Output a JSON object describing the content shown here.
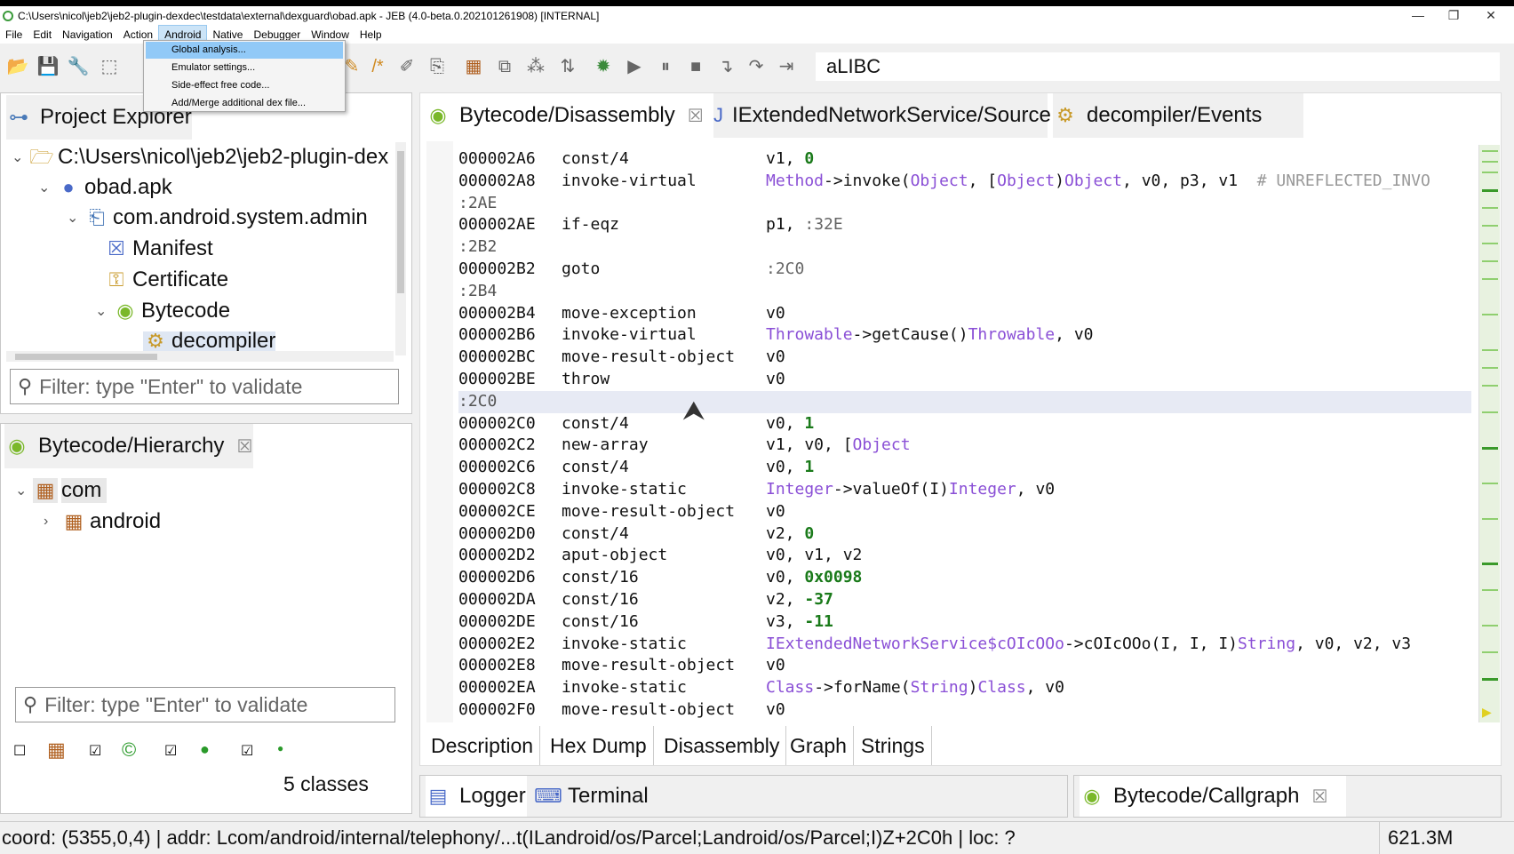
{
  "window": {
    "title": "C:\\Users\\nicol\\jeb2\\jeb2-plugin-dexdec\\testdata\\external\\dexguard\\obad.apk - JEB (4.0-beta.0.202101261908) [INTERNAL]",
    "minimize": "—",
    "restore": "❐",
    "close": "✕"
  },
  "menu": [
    "File",
    "Edit",
    "Navigation",
    "Action",
    "Android",
    "Native",
    "Debugger",
    "Window",
    "Help"
  ],
  "android_menu": [
    "Global analysis...",
    "Emulator settings...",
    "Side-effect free code...",
    "Add/Merge additional dex file..."
  ],
  "search": {
    "value": "aLIBC"
  },
  "project_explorer": {
    "tab": "Project Explorer",
    "tree": [
      {
        "label": "C:\\Users\\nicol\\jeb2\\jeb2-plugin-dex",
        "icon": "folder-icon"
      },
      {
        "label": "obad.apk",
        "icon": "apk-icon"
      },
      {
        "label": "com.android.system.admin",
        "icon": "package-icon"
      },
      {
        "label": "Manifest",
        "icon": "manifest-icon"
      },
      {
        "label": "Certificate",
        "icon": "key-icon"
      },
      {
        "label": "Bytecode",
        "icon": "android-icon"
      },
      {
        "label": "decompiler",
        "icon": "decompiler-icon"
      }
    ],
    "filter_placeholder": "Filter: type \"Enter\" to validate"
  },
  "hierarchy": {
    "tab": "Bytecode/Hierarchy",
    "tree": [
      {
        "label": "com"
      },
      {
        "label": "android"
      }
    ],
    "filter_placeholder": "Filter: type \"Enter\" to validate",
    "classes_count": "5 classes"
  },
  "editor_tabs": [
    "Bytecode/Disassembly",
    "IExtendedNetworkService/Source",
    "decompiler/Events"
  ],
  "code": [
    {
      "addr": "000002A6",
      "op": "const/4",
      "args": [
        [
          "v1, ",
          ""
        ],
        [
          "0",
          "n"
        ]
      ]
    },
    {
      "addr": "000002A8",
      "op": "invoke-virtual",
      "args": [
        [
          "Method",
          "t"
        ],
        [
          "->invoke(",
          ""
        ],
        [
          "Object",
          "t"
        ],
        [
          ", [",
          ""
        ],
        [
          "Object",
          "t"
        ],
        [
          ")",
          ""
        ],
        [
          "Object",
          "t"
        ],
        [
          ", v0, p3, v1  ",
          ""
        ],
        [
          "# UNREFLECTED_INVO",
          "c"
        ]
      ]
    },
    {
      "label": ":2AE"
    },
    {
      "addr": "000002AE",
      "op": "if-eqz",
      "args": [
        [
          "p1, ",
          ""
        ],
        [
          ":32E",
          "lbl"
        ]
      ]
    },
    {
      "label": ":2B2"
    },
    {
      "addr": "000002B2",
      "op": "goto",
      "args": [
        [
          ":2C0",
          "lbl"
        ]
      ]
    },
    {
      "label": ":2B4"
    },
    {
      "addr": "000002B4",
      "op": "move-exception",
      "args": [
        [
          "v0",
          ""
        ]
      ]
    },
    {
      "addr": "000002B6",
      "op": "invoke-virtual",
      "args": [
        [
          "Throwable",
          "t"
        ],
        [
          "->getCause()",
          ""
        ],
        [
          "Throwable",
          "t"
        ],
        [
          ", v0",
          ""
        ]
      ]
    },
    {
      "addr": "000002BC",
      "op": "move-result-object",
      "args": [
        [
          "v0",
          ""
        ]
      ]
    },
    {
      "addr": "000002BE",
      "op": "throw",
      "args": [
        [
          "v0",
          ""
        ]
      ]
    },
    {
      "label": ":2C0",
      "highlight": true
    },
    {
      "addr": "000002C0",
      "op": "const/4",
      "args": [
        [
          "v0, ",
          ""
        ],
        [
          "1",
          "n"
        ]
      ]
    },
    {
      "addr": "000002C2",
      "op": "new-array",
      "args": [
        [
          "v1, v0, [",
          ""
        ],
        [
          "Object",
          "t"
        ]
      ]
    },
    {
      "addr": "000002C6",
      "op": "const/4",
      "args": [
        [
          "v0, ",
          ""
        ],
        [
          "1",
          "n"
        ]
      ]
    },
    {
      "addr": "000002C8",
      "op": "invoke-static",
      "args": [
        [
          "Integer",
          "t"
        ],
        [
          "->valueOf(I)",
          ""
        ],
        [
          "Integer",
          "t"
        ],
        [
          ", v0",
          ""
        ]
      ]
    },
    {
      "addr": "000002CE",
      "op": "move-result-object",
      "args": [
        [
          "v0",
          ""
        ]
      ]
    },
    {
      "addr": "000002D0",
      "op": "const/4",
      "args": [
        [
          "v2, ",
          ""
        ],
        [
          "0",
          "n"
        ]
      ]
    },
    {
      "addr": "000002D2",
      "op": "aput-object",
      "args": [
        [
          "v0, v1, v2",
          ""
        ]
      ]
    },
    {
      "addr": "000002D6",
      "op": "const/16",
      "args": [
        [
          "v0, ",
          ""
        ],
        [
          "0x0098",
          "n"
        ]
      ]
    },
    {
      "addr": "000002DA",
      "op": "const/16",
      "args": [
        [
          "v2, ",
          ""
        ],
        [
          "-37",
          "n"
        ]
      ]
    },
    {
      "addr": "000002DE",
      "op": "const/16",
      "args": [
        [
          "v3, ",
          ""
        ],
        [
          "-11",
          "n"
        ]
      ]
    },
    {
      "addr": "000002E2",
      "op": "invoke-static",
      "args": [
        [
          "IExtendedNetworkService$cOIcOOo",
          "t"
        ],
        [
          "->cOIcOOo(I, I, I)",
          ""
        ],
        [
          "String",
          "t"
        ],
        [
          ", v0, v2, v3",
          ""
        ]
      ]
    },
    {
      "addr": "000002E8",
      "op": "move-result-object",
      "args": [
        [
          "v0",
          ""
        ]
      ]
    },
    {
      "addr": "000002EA",
      "op": "invoke-static",
      "args": [
        [
          "Class",
          "t"
        ],
        [
          "->forName(",
          ""
        ],
        [
          "String",
          "t"
        ],
        [
          ")",
          ""
        ],
        [
          "Class",
          "t"
        ],
        [
          ", v0",
          ""
        ]
      ]
    },
    {
      "addr": "000002F0",
      "op": "move-result-object",
      "args": [
        [
          "v0",
          ""
        ]
      ]
    }
  ],
  "view_tabs": [
    "Description",
    "Hex Dump",
    "Disassembly",
    "Graph",
    "Strings"
  ],
  "bottom_tabs": {
    "logger": "Logger",
    "terminal": "Terminal",
    "callgraph": "Bytecode/Callgraph"
  },
  "status": {
    "left": "coord: (5355,0,4) | addr: Lcom/android/internal/telephony/...t(ILandroid/os/Parcel;Landroid/os/Parcel;I)Z+2C0h | loc: ?",
    "memory": "621.3M"
  }
}
